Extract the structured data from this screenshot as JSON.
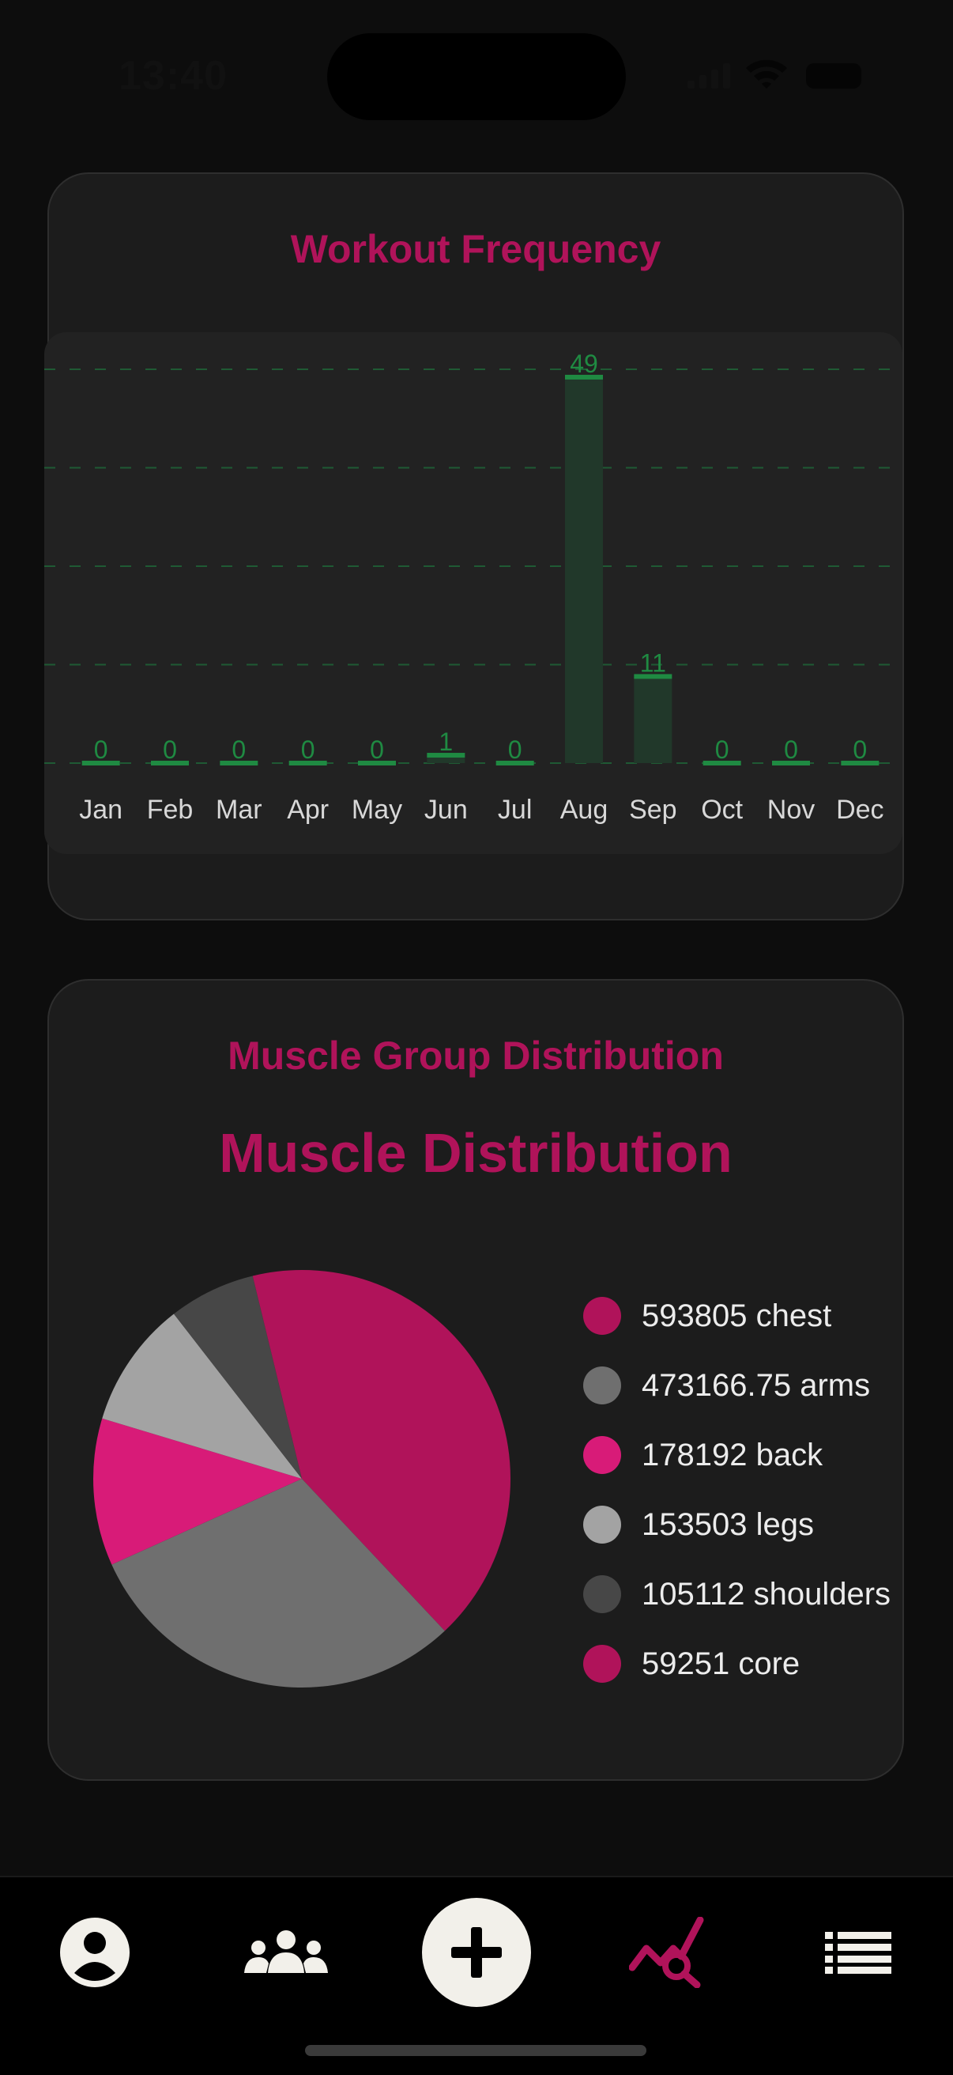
{
  "status_bar": {
    "time": "13:40"
  },
  "frequency_card": {
    "title": "Workout Frequency"
  },
  "chart_data": [
    {
      "type": "bar",
      "title": "Workout Frequency",
      "categories": [
        "Jan",
        "Feb",
        "Mar",
        "Apr",
        "May",
        "Jun",
        "Jul",
        "Aug",
        "Sep",
        "Oct",
        "Nov",
        "Dec"
      ],
      "values": [
        0,
        0,
        0,
        0,
        0,
        1,
        0,
        49,
        11,
        0,
        0,
        0
      ],
      "xlabel": "",
      "ylabel": "",
      "ylim": [
        0,
        50
      ],
      "grid": true,
      "colors": {
        "bar": "#1f8a42",
        "bar_fill": "#21382a",
        "grid": "#1f5a34",
        "label": "#1f8a42"
      }
    },
    {
      "type": "pie",
      "title": "Muscle Distribution",
      "categories": [
        "chest",
        "arms",
        "back",
        "legs",
        "shoulders",
        "core"
      ],
      "values": [
        593805,
        473166.75,
        178192,
        153503,
        105112,
        59251
      ],
      "colors": [
        "#b0135a",
        "#6f6f6f",
        "#d81b78",
        "#a3a3a3",
        "#474747",
        "#b0135a"
      ],
      "legend_position": "right"
    }
  ],
  "muscle_card": {
    "title": "Muscle Group Distribution",
    "chart_title": "Muscle Distribution",
    "legend": [
      {
        "label": "593805 chest",
        "color": "#b0135a"
      },
      {
        "label": "473166.75 arms",
        "color": "#6f6f6f"
      },
      {
        "label": "178192 back",
        "color": "#d81b78"
      },
      {
        "label": "153503 legs",
        "color": "#a3a3a3"
      },
      {
        "label": "105112 shoulders",
        "color": "#474747"
      },
      {
        "label": "59251 core",
        "color": "#b0135a"
      }
    ]
  },
  "tabbar": {
    "items": [
      {
        "icon": "profile-icon",
        "active": false
      },
      {
        "icon": "community-icon",
        "active": false
      },
      {
        "icon": "add-icon",
        "active": false
      },
      {
        "icon": "analytics-icon",
        "active": true
      },
      {
        "icon": "list-icon",
        "active": false
      }
    ],
    "active_color": "#b0135a"
  }
}
